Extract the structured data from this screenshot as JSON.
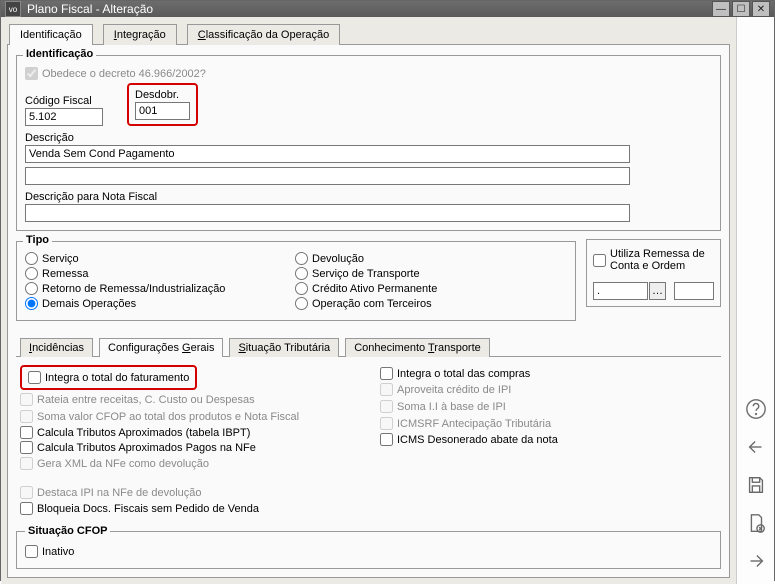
{
  "window": {
    "title": "Plano Fiscal - Alteração"
  },
  "mainTabs": {
    "t0": "Identificação",
    "t1_pre": "I",
    "t1": "ntegração",
    "t2_pre": "C",
    "t2": "lassificação da Operação"
  },
  "identGroup": {
    "title": "Identificação",
    "decree": "Obedece o decreto 46.966/2002?",
    "codigoLabel": "Código Fiscal",
    "codigoValue": "5.102",
    "desdobrLabel": "Desdobr.",
    "desdobrValue": "001",
    "descLabel": "Descrição",
    "descValue": "Venda Sem Cond Pagamento",
    "descNFLabel": "Descrição para Nota Fiscal"
  },
  "tipoGroup": {
    "title": "Tipo",
    "servico": "Serviço",
    "remessa": "Remessa",
    "retorno": "Retorno de Remessa/Industrialização",
    "demais": "Demais Operações",
    "devolucao": "Devolução",
    "servTransp": "Serviço de Transporte",
    "credito": "Crédito Ativo Permanente",
    "opTerc": "Operação com Terceiros"
  },
  "remessaBox": {
    "chk": "Utiliza Remessa de Conta e Ordem",
    "val": "."
  },
  "subTabs": {
    "inc_pre": "I",
    "inc": "ncidências",
    "cfg": "Configurações ",
    "cfg_ul": "G",
    "cfg2": "erais",
    "sit_pre": "S",
    "sit": "ituação Tributária",
    "con": "Conhecimento ",
    "con_ul": "T",
    "con2": "ransporte"
  },
  "configChecks": {
    "left": {
      "integra": "Integra o total do faturamento",
      "rateia": "Rateia entre receitas, C. Custo ou Despesas",
      "soma": "Soma valor CFOP ao total dos produtos e Nota Fiscal",
      "tribAprox": "Calcula Tributos Aproximados (tabela IBPT)",
      "tribNfe": "Calcula Tributos Aproximados Pagos na NFe",
      "geraXml": "Gera XML da NFe como devolução",
      "destacaIpi": "Destaca IPI na NFe de devolução",
      "bloqueia": "Bloqueia Docs. Fiscais sem Pedido de Venda"
    },
    "right": {
      "integraCompras": "Integra o total das compras",
      "aproveita": "Aproveita crédito de IPI",
      "somaII": "Soma I.I à base de IPI",
      "icmsrf": "ICMSRF Antecipação Tributária",
      "icmsDes": "ICMS Desonerado abate da nota"
    }
  },
  "situacao": {
    "title": "Situação CFOP",
    "inativo": "Inativo"
  }
}
